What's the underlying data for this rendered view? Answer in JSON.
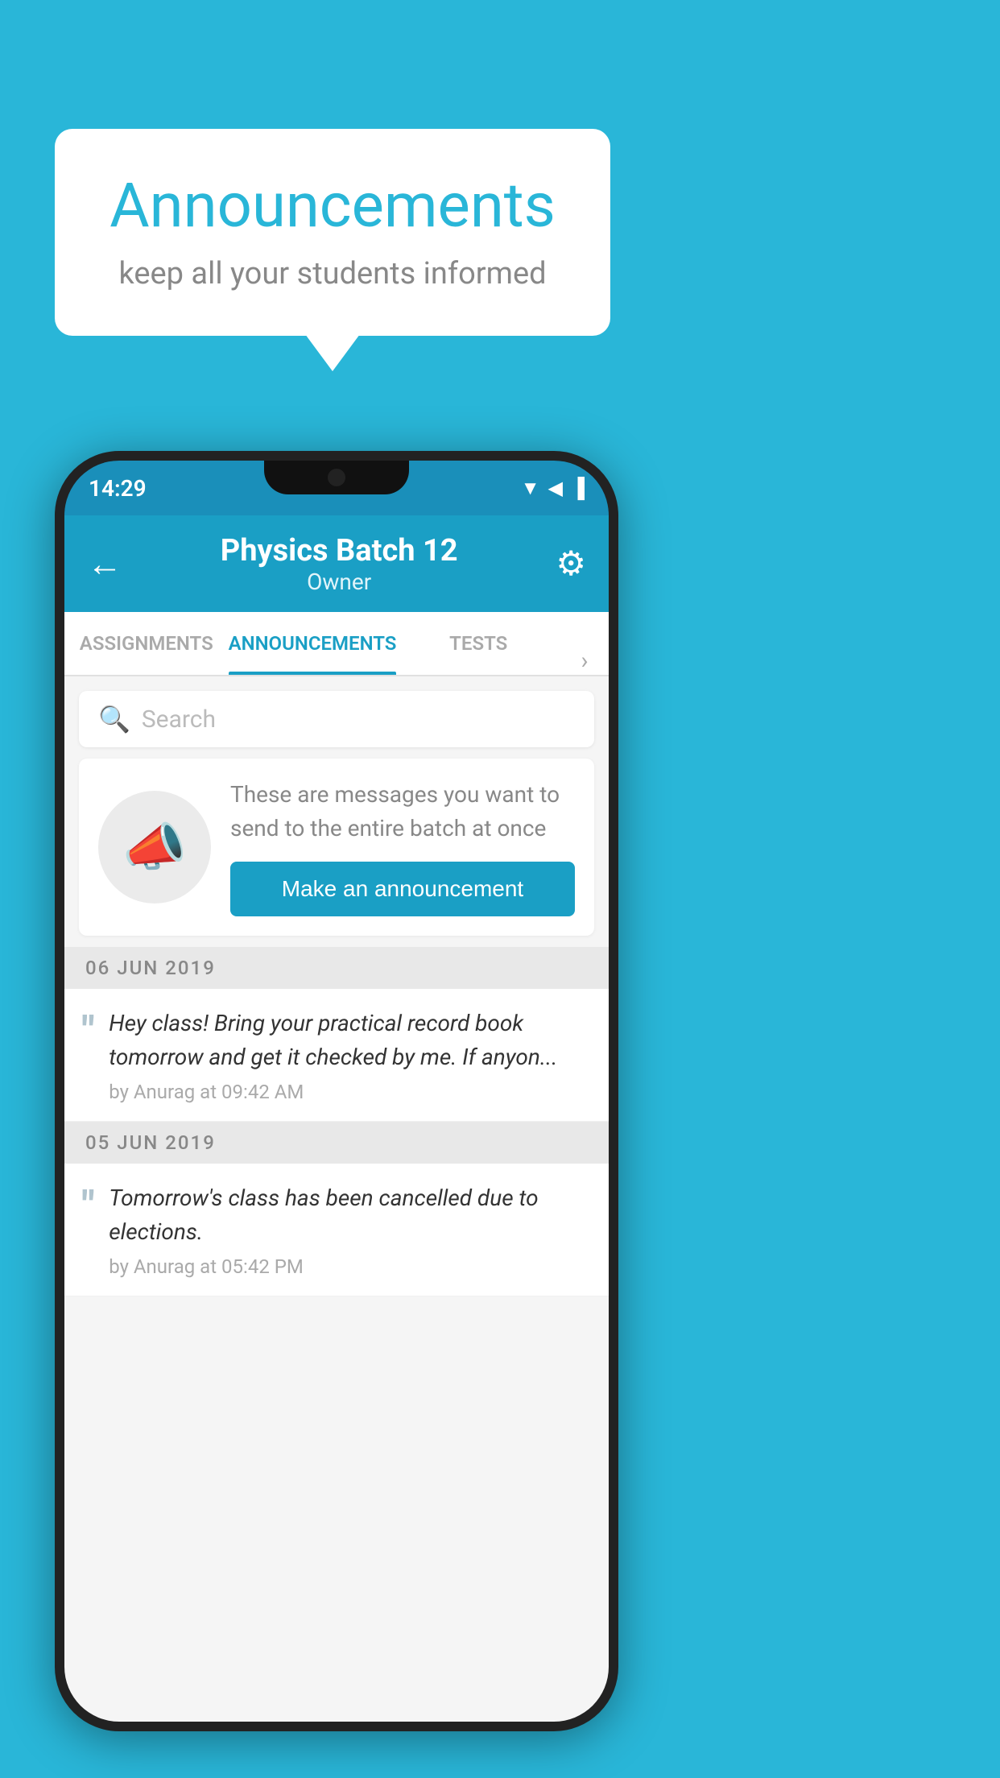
{
  "background": {
    "color": "#29b6d8"
  },
  "speech_bubble": {
    "title": "Announcements",
    "subtitle": "keep all your students informed"
  },
  "phone": {
    "status_bar": {
      "time": "14:29",
      "icons": [
        "▼◀▐"
      ]
    },
    "header": {
      "title": "Physics Batch 12",
      "subtitle": "Owner",
      "back_label": "←",
      "gear_label": "⚙"
    },
    "tabs": [
      {
        "label": "ASSIGNMENTS",
        "active": false
      },
      {
        "label": "ANNOUNCEMENTS",
        "active": true
      },
      {
        "label": "TESTS",
        "active": false
      }
    ],
    "search": {
      "placeholder": "Search"
    },
    "announcement_card": {
      "description": "These are messages you want to send to the entire batch at once",
      "button_label": "Make an announcement"
    },
    "announcement_list": [
      {
        "date": "06  JUN  2019",
        "message": "Hey class! Bring your practical record book tomorrow and get it checked by me. If anyon...",
        "meta": "by Anurag at 09:42 AM"
      },
      {
        "date": "05  JUN  2019",
        "message": "Tomorrow's class has been cancelled due to elections.",
        "meta": "by Anurag at 05:42 PM"
      }
    ]
  }
}
